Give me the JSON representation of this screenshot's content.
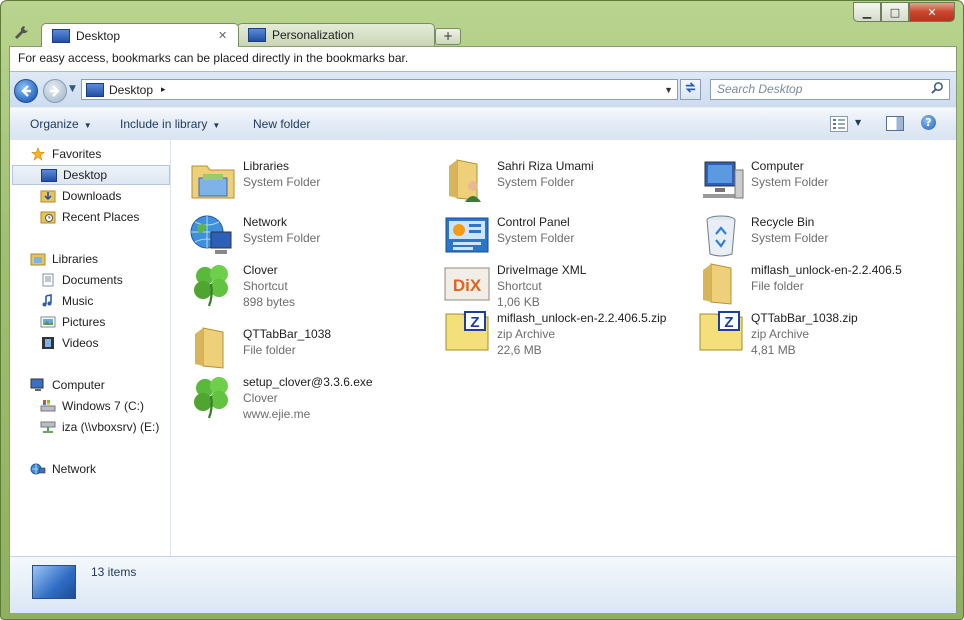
{
  "window": {
    "caption_min": "▁",
    "caption_max": "□",
    "caption_close": "✕"
  },
  "tabs": [
    {
      "label": "Desktop",
      "close": "✕"
    },
    {
      "label": "Personalization",
      "close": ""
    }
  ],
  "newtab_label": "+",
  "bookmarks_bar": {
    "text": "For easy access, bookmarks can be placed directly in the bookmarks bar."
  },
  "address": {
    "location": "Desktop",
    "arrow": "▸",
    "drop": "▼"
  },
  "search": {
    "placeholder": "Search Desktop",
    "icon": "⌕"
  },
  "toolbar": {
    "organize": "Organize",
    "include_in_library": "Include in library",
    "new_folder": "New folder",
    "help": "?"
  },
  "nav": {
    "favorites": "Favorites",
    "desktop": "Desktop",
    "downloads": "Downloads",
    "recent_places": "Recent Places",
    "libraries": "Libraries",
    "documents": "Documents",
    "music": "Music",
    "pictures": "Pictures",
    "videos": "Videos",
    "computer": "Computer",
    "windows7": "Windows 7 (C:)",
    "iza": "iza (\\\\vboxsrv) (E:)",
    "network": "Network"
  },
  "items": [
    {
      "name": "Libraries",
      "type": "System Folder",
      "extra": ""
    },
    {
      "name": "Sahri Riza Umami",
      "type": "System Folder",
      "extra": ""
    },
    {
      "name": "Computer",
      "type": "System Folder",
      "extra": ""
    },
    {
      "name": "Network",
      "type": "System Folder",
      "extra": ""
    },
    {
      "name": "Control Panel",
      "type": "System Folder",
      "extra": ""
    },
    {
      "name": "Recycle Bin",
      "type": "System Folder",
      "extra": ""
    },
    {
      "name": "Clover",
      "type": "Shortcut",
      "extra": "898 bytes"
    },
    {
      "name": "DriveImage XML",
      "type": "Shortcut",
      "extra": "1,06 KB"
    },
    {
      "name": "miflash_unlock-en-2.2.406.5",
      "type": "File folder",
      "extra": ""
    },
    {
      "name": "QTTabBar_1038",
      "type": "File folder",
      "extra": ""
    },
    {
      "name": "miflash_unlock-en-2.2.406.5.zip",
      "type": "zip Archive",
      "extra": "22,6 MB"
    },
    {
      "name": "QTTabBar_1038.zip",
      "type": "zip Archive",
      "extra": "4,81 MB"
    },
    {
      "name": "setup_clover@3.3.6.exe",
      "type": "Clover",
      "extra": "www.ejie.me"
    }
  ],
  "dix_label": "DiX",
  "zip_label": "Z",
  "status": {
    "count": "13 items"
  }
}
